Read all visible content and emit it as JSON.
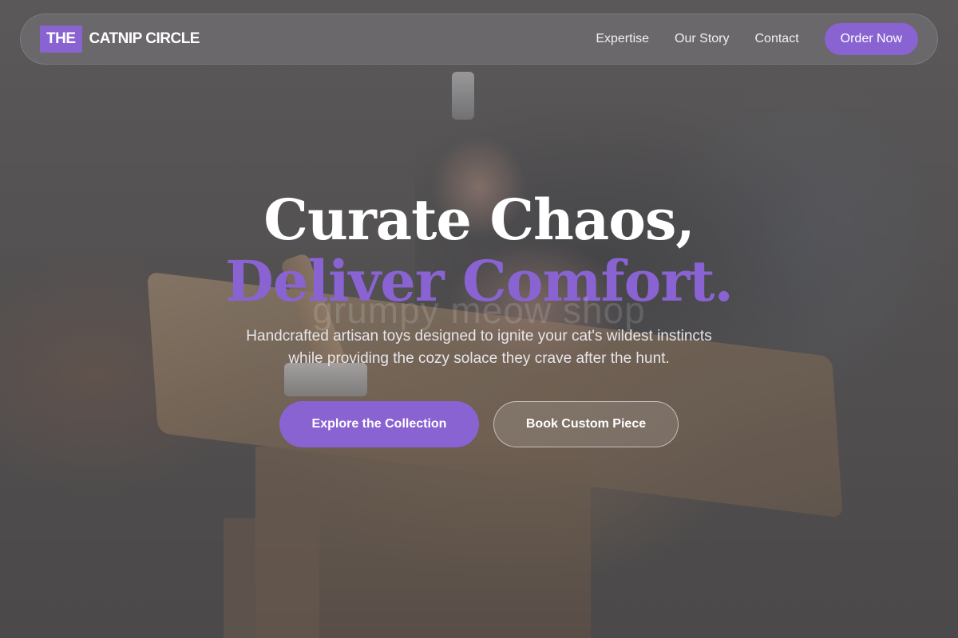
{
  "brand": {
    "badge": "THE",
    "name": "CATNIP CIRCLE"
  },
  "nav": {
    "links": [
      "Expertise",
      "Our Story",
      "Contact"
    ],
    "cta": "Order Now"
  },
  "hero": {
    "headline_line1": "Curate Chaos,",
    "headline_line2": "Deliver Comfort.",
    "watermark": "grumpy meow shop",
    "subtitle_line1": "Handcrafted artisan toys designed to ignite your cat's wildest instincts",
    "subtitle_line2": "while providing the cozy solace they crave after the hunt.",
    "primary_button": "Explore the Collection",
    "secondary_button": "Book Custom Piece"
  },
  "colors": {
    "accent": "#8a63d2",
    "text_light": "#ffffff"
  }
}
